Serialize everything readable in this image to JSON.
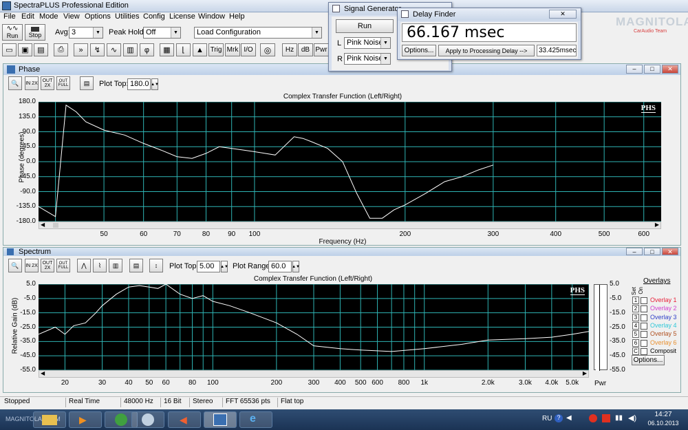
{
  "app": {
    "title": "SpectraPLUS Professional Edition"
  },
  "menu": [
    "File",
    "Edit",
    "Mode",
    "View",
    "Options",
    "Utilities",
    "Config",
    "License",
    "Window",
    "Help"
  ],
  "toolbar": {
    "run": "Run",
    "stop": "Stop",
    "avg_label": "Avg:",
    "avg_value": "3",
    "peak_label": "Peak Hold:",
    "peak_value": "Off",
    "load_config": "Load Configuration",
    "buttons": [
      "Trig",
      "Mrk",
      "I/O",
      "Hz",
      "dB",
      "Pwr"
    ]
  },
  "siggen": {
    "title": "Signal Generator",
    "run": "Run",
    "l": "L",
    "r": "R",
    "l_value": "Pink Noise",
    "r_value": "Pink Noise"
  },
  "delay": {
    "title": "Delay Finder",
    "value": "66.167 msec",
    "options": "Options...",
    "apply": "Apply to Processing Delay -->",
    "delay_field": "33.425msec"
  },
  "watermark": {
    "main": "MAGNITOLA",
    "sub": "CarAudio Team"
  },
  "phase": {
    "pane_title": "Phase",
    "plot_top_label": "Plot Top:",
    "plot_top_value": "180.0",
    "zoom_in": "IN 2X",
    "zoom_out": "OUT 2X",
    "zoom_full": "OUT FULL"
  },
  "spectrum": {
    "pane_title": "Spectrum",
    "plot_top_label": "Plot Top:",
    "plot_top_value": "5.00",
    "plot_range_label": "Plot Range:",
    "plot_range_value": "60.0",
    "zoom_in": "IN 2X",
    "zoom_out": "OUT 2X",
    "zoom_full": "OUT FULL",
    "pwr_label": "Pwr"
  },
  "overlays": {
    "title": "Overlays",
    "set_label": "Set",
    "on_label": "On",
    "items": [
      {
        "num": "1",
        "label": "Overlay 1",
        "color": "#e8203a"
      },
      {
        "num": "2",
        "label": "Overlay 2",
        "color": "#d040d0"
      },
      {
        "num": "3",
        "label": "Overlay 3",
        "color": "#3040c8"
      },
      {
        "num": "4",
        "label": "Overlay 4",
        "color": "#30c8d8"
      },
      {
        "num": "5",
        "label": "Overlay 5",
        "color": "#b05020"
      },
      {
        "num": "6",
        "label": "Overlay 6",
        "color": "#e89030"
      },
      {
        "num": "C",
        "label": "Composit",
        "color": "#000000"
      }
    ],
    "options": "Options..."
  },
  "chart_data": [
    {
      "type": "line",
      "title": "Complex Transfer Function (Left/Right)",
      "badge": "PHS",
      "xlabel": "Frequency (Hz)",
      "ylabel": "Phase (degrees)",
      "xscale": "log",
      "xlim": [
        37,
        650
      ],
      "ylim": [
        -180,
        180
      ],
      "yticks": [
        "180.0",
        "135.0",
        "90.0",
        "45.0",
        "0.0",
        "-45.0",
        "-90.0",
        "-135.0",
        "-180.0"
      ],
      "xticks": [
        "50",
        "60",
        "70",
        "80",
        "90",
        "100",
        "200",
        "300",
        "400",
        "500",
        "600"
      ],
      "x": [
        37,
        40,
        42,
        44,
        46,
        50,
        55,
        60,
        65,
        70,
        75,
        80,
        85,
        90,
        95,
        100,
        110,
        120,
        125,
        130,
        140,
        150,
        160,
        170,
        180,
        190,
        200,
        220,
        240,
        260,
        280,
        300
      ],
      "y": [
        -135,
        -165,
        170,
        150,
        120,
        95,
        80,
        55,
        35,
        15,
        10,
        25,
        45,
        40,
        35,
        30,
        20,
        75,
        70,
        60,
        40,
        0,
        -95,
        -170,
        -170,
        -145,
        -130,
        -95,
        -60,
        -45,
        -25,
        -10
      ]
    },
    {
      "type": "line",
      "title": "Complex Transfer Function (Left/Right)",
      "badge": "PHS",
      "ylabel": "Relative Gain (dB)",
      "xscale": "log",
      "xlim": [
        15,
        6000
      ],
      "ylim": [
        -55,
        5
      ],
      "yticks": [
        "5.0",
        "-5.0",
        "-15.0",
        "-25.0",
        "-35.0",
        "-45.0",
        "-55.0"
      ],
      "xticks": [
        "20",
        "30",
        "40",
        "50",
        "60",
        "80",
        "100",
        "200",
        "300",
        "400",
        "500",
        "600",
        "800",
        "1k",
        "2.0k",
        "3.0k",
        "4.0k",
        "5.0k"
      ],
      "x": [
        15,
        18,
        20,
        22,
        25,
        28,
        30,
        35,
        40,
        45,
        50,
        55,
        60,
        70,
        80,
        90,
        100,
        120,
        150,
        200,
        250,
        300,
        400,
        500,
        700,
        1000,
        1500,
        2000,
        3000,
        4000,
        5000,
        6000
      ],
      "y": [
        -30,
        -25,
        -30,
        -24,
        -22,
        -15,
        -10,
        -2,
        3,
        4,
        3,
        2,
        5,
        -2,
        -5,
        -3,
        -7,
        -10,
        -15,
        -22,
        -30,
        -38,
        -40,
        -41,
        -42,
        -40,
        -37,
        -34,
        -33,
        -32,
        -30,
        -28
      ]
    }
  ],
  "statusbar": [
    "Stopped",
    "Real Time",
    "48000 Hz",
    "16 Bit",
    "Stereo",
    "FFT 65536 pts",
    "Flat top"
  ],
  "taskbar": {
    "lang": "RU",
    "time": "14:27",
    "date": "06.10.2013",
    "label": "MAGNITOLA TEAM"
  }
}
